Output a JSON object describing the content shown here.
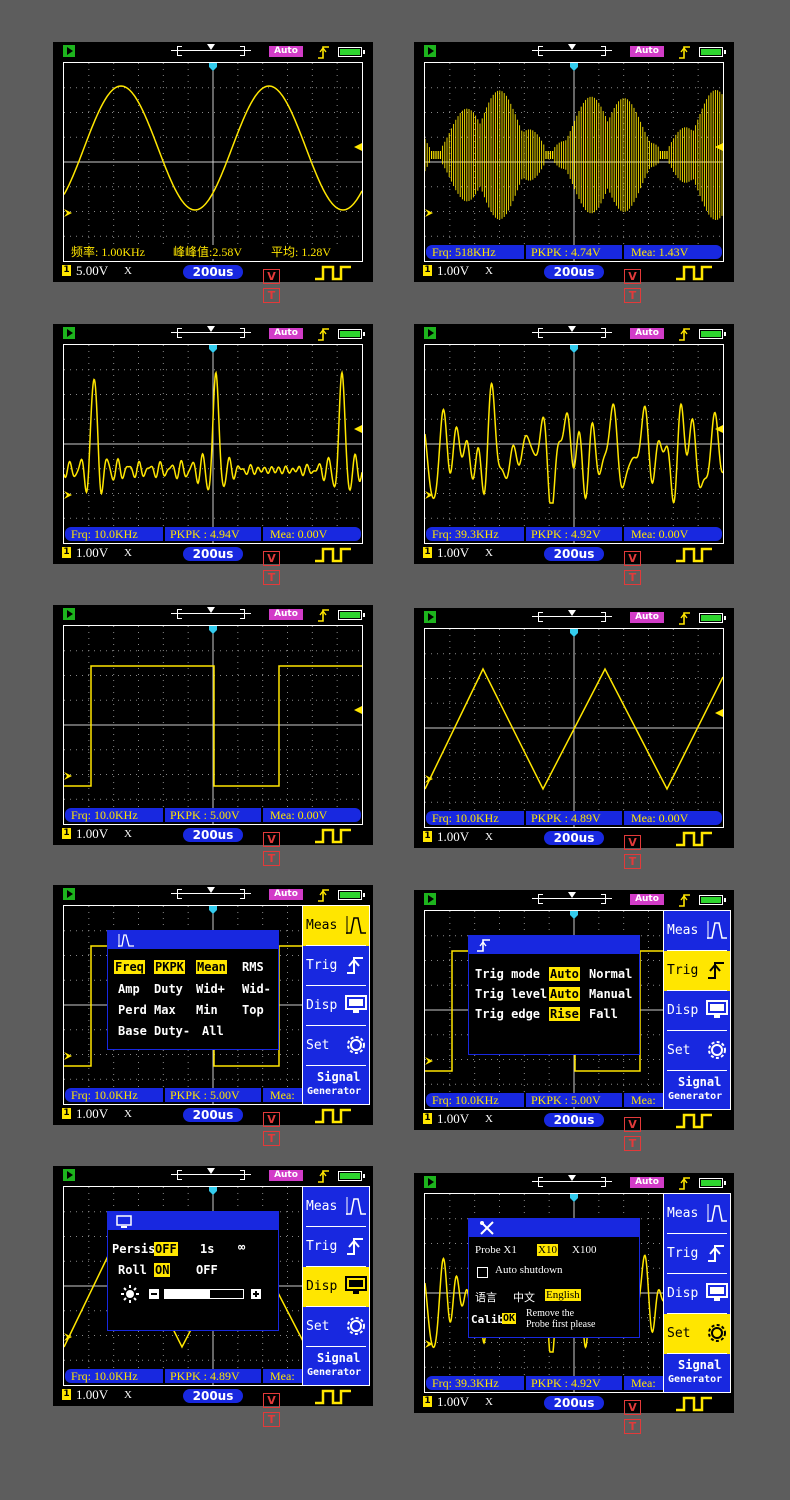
{
  "top": {
    "auto": "Auto"
  },
  "bottom": {
    "timebase": "200us",
    "v": "V",
    "t": "T",
    "channel": "1",
    "probe": "X"
  },
  "menu": {
    "meas": "Meas",
    "trig": "Trig",
    "disp": "Disp",
    "set": "Set",
    "sig1": "Signal",
    "sig2": "Generator"
  },
  "screens": [
    {
      "volts": "5.00V",
      "wave": "sine",
      "chinese": true,
      "m1": "频率: 1.00KHz",
      "m2": "峰峰值:2.58V",
      "m3": "平均: 1.28V"
    },
    {
      "volts": "1.00V",
      "wave": "am",
      "m1": "Frq: 518KHz",
      "m2": "PKPK : 4.74V",
      "m3": "Mea: 1.43V"
    },
    {
      "volts": "1.00V",
      "wave": "sinc",
      "m1": "Frq: 10.0KHz",
      "m2": "PKPK : 4.94V",
      "m3": "Mea: 0.00V"
    },
    {
      "volts": "1.00V",
      "wave": "random",
      "m1": "Frq: 39.3KHz",
      "m2": "PKPK : 4.92V",
      "m3": "Mea: 0.00V"
    },
    {
      "volts": "1.00V",
      "wave": "square",
      "m1": "Frq: 10.0KHz",
      "m2": "PKPK : 5.00V",
      "m3": "Mea: 0.00V"
    },
    {
      "volts": "1.00V",
      "wave": "triangle",
      "m1": "Frq: 10.0KHz",
      "m2": "PKPK : 4.89V",
      "m3": "Mea: 0.00V"
    },
    {
      "volts": "1.00V",
      "wave": "square",
      "m1": "Frq: 10.0KHz",
      "m2": "PKPK : 5.00V",
      "m3": "Mea:",
      "menu": "meas"
    },
    {
      "volts": "1.00V",
      "wave": "square",
      "m1": "Frq: 10.0KHz",
      "m2": "PKPK : 5.00V",
      "m3": "Mea:",
      "menu": "trig"
    },
    {
      "volts": "1.00V",
      "wave": "triangle",
      "m1": "Frq: 10.0KHz",
      "m2": "PKPK : 4.89V",
      "m3": "Mea:",
      "menu": "disp"
    },
    {
      "volts": "1.00V",
      "wave": "random",
      "m1": "Frq: 39.3KHz",
      "m2": "PKPK : 4.92V",
      "m3": "Mea:",
      "menu": "set"
    }
  ],
  "meas_popup": {
    "items": [
      "Freq",
      "PKPK",
      "Mean",
      "RMS",
      "Amp",
      "Duty",
      "Wid+",
      "Wid-",
      "Perd",
      "Max",
      "Min",
      "Top",
      "Base",
      "Duty-",
      "All"
    ],
    "highlighted": [
      "Freq",
      "PKPK",
      "Mean"
    ]
  },
  "trig_popup": {
    "mode_label": "Trig mode",
    "mode_a": "Auto",
    "mode_b": "Normal",
    "level_label": "Trig level",
    "level_a": "Auto",
    "level_b": "Manual",
    "edge_label": "Trig edge",
    "edge_a": "Rise",
    "edge_b": "Fall"
  },
  "disp_popup": {
    "persist": "Persist",
    "off": "OFF",
    "one": "1s",
    "inf": "∞",
    "roll": "Roll",
    "on": "ON",
    "off2": "OFF",
    "brightness": 0.58
  },
  "set_popup": {
    "probe": "Probe X1",
    "x10": "X10",
    "x100": "X100",
    "auto_shutdown": "Auto shutdown",
    "lang_cn": "语言",
    "lang_zh": "中文",
    "lang_en": "English",
    "calib": "Calib",
    "ok": "OK",
    "note1": "Remove the",
    "note2": "Probe first please"
  }
}
